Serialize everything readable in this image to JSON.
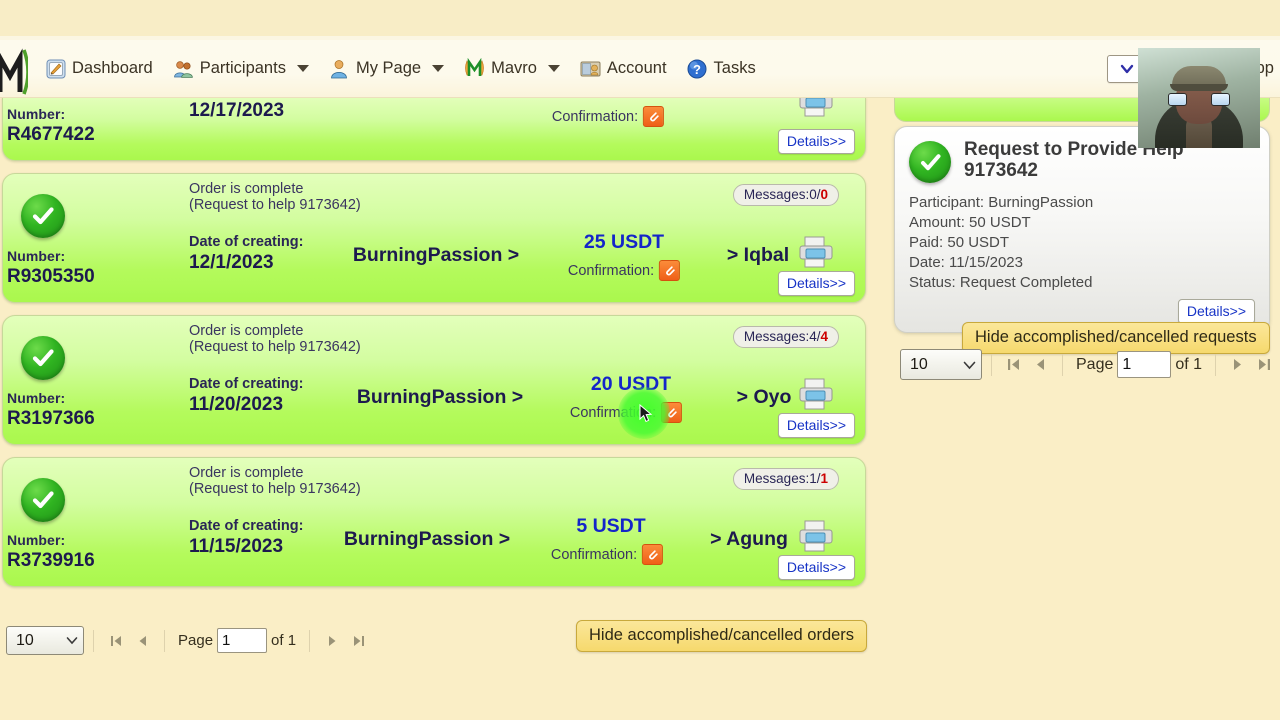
{
  "navbar": {
    "logo_name": "mmm-logo",
    "items": [
      {
        "label": "Dashboard",
        "icon": "dashboard-icon",
        "has_caret": false
      },
      {
        "label": "Participants",
        "icon": "participants-icon",
        "has_caret": true
      },
      {
        "label": "My Page",
        "icon": "my-page-icon",
        "has_caret": true
      },
      {
        "label": "Mavro",
        "icon": "mavro-icon",
        "has_caret": true
      },
      {
        "label": "Account",
        "icon": "account-icon",
        "has_caret": false
      },
      {
        "label": "Tasks",
        "icon": "tasks-icon",
        "has_caret": false
      }
    ],
    "language_select": {
      "icon": "chevron-down-icon"
    },
    "support": {
      "label": "Supp",
      "icon": "ticket-icon"
    }
  },
  "orders": [
    {
      "number_label": "Number:",
      "number": "R4677422",
      "date": "12/17/2023",
      "confirmation_label": "Confirmation:",
      "details_label": "Details>>",
      "clipped_top": true
    },
    {
      "status_line1": "Order is complete",
      "status_line2": "(Request to help 9173642)",
      "number_label": "Number:",
      "number": "R9305350",
      "date_label": "Date of creating:",
      "date": "12/1/2023",
      "from": "BurningPassion >",
      "amount": "25 USDT",
      "confirmation_label": "Confirmation:",
      "to": "> Iqbal",
      "messages_label": "Messages:",
      "messages_read": "0",
      "messages_unread": "0",
      "details_label": "Details>>"
    },
    {
      "status_line1": "Order is complete",
      "status_line2": "(Request to help 9173642)",
      "number_label": "Number:",
      "number": "R3197366",
      "date_label": "Date of creating:",
      "date": "11/20/2023",
      "from": "BurningPassion >",
      "amount": "20 USDT",
      "confirmation_label": "Confirmation:",
      "to": "> Oyo",
      "messages_label": "Messages:",
      "messages_read": "4",
      "messages_unread": "4",
      "details_label": "Details>>"
    },
    {
      "status_line1": "Order is complete",
      "status_line2": "(Request to help 9173642)",
      "number_label": "Number:",
      "number": "R3739916",
      "date_label": "Date of creating:",
      "date": "11/15/2023",
      "from": "BurningPassion >",
      "amount": "5 USDT",
      "confirmation_label": "Confirmation:",
      "to": "> Agung",
      "messages_label": "Messages:",
      "messages_read": "1",
      "messages_unread": "1",
      "details_label": "Details>>"
    }
  ],
  "orders_pager": {
    "page_size": "10",
    "page_word": "Page",
    "page_value": "1",
    "of_text": "of 1",
    "hide_label": "Hide accomplished/cancelled orders"
  },
  "request_card": {
    "title_line1": "Request to Provide Help",
    "title_line2": "9173642",
    "participant": "Participant: BurningPassion",
    "amount": "Amount: 50 USDT",
    "paid": "Paid: 50 USDT",
    "date": "Date: 11/15/2023",
    "status": "Status: Request Completed",
    "details_label": "Details>>"
  },
  "requests_pager": {
    "page_size": "10",
    "page_word": "Page",
    "page_value": "1",
    "of_text": "of 1",
    "hide_label": "Hide accomplished/cancelled requests"
  },
  "colors": {
    "page_bg": "#faeec6",
    "navbar_bg": "#fdfaed",
    "card_green_top": "#e3ffbb",
    "card_green_bottom": "#aaf84d",
    "amount_blue": "#1425c9",
    "unread_red": "#cc0000",
    "hide_button_yellow": "#f6d96d",
    "confirm_orange": "#ef5f17",
    "cursor_glow_green": "#3cff28"
  }
}
